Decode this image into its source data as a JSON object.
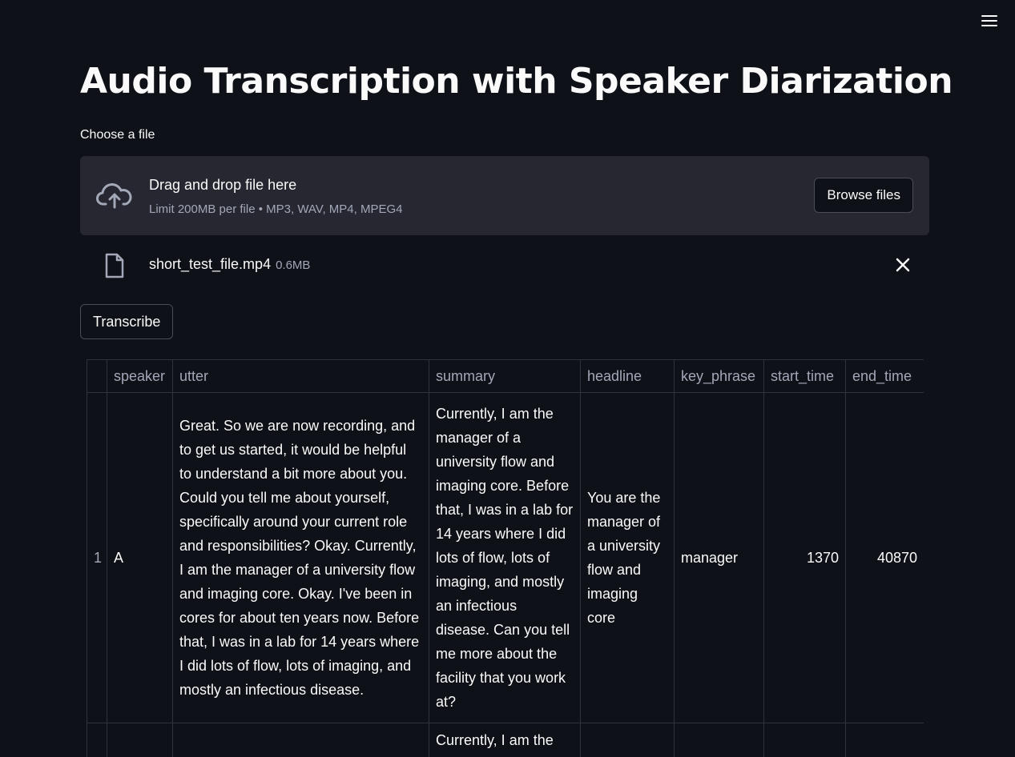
{
  "app": {
    "title": "Audio Transcription with Speaker Diarization",
    "menu_icon": "hamburger-menu-icon"
  },
  "uploader": {
    "label": "Choose a file",
    "drop_text": "Drag and drop file here",
    "limit_text": "Limit 200MB per file • MP3, WAV, MP4, MPEG4",
    "browse_label": "Browse files",
    "icon": "cloud-upload-icon"
  },
  "file": {
    "name": "short_test_file.mp4",
    "size": "0.6MB",
    "icon": "file-icon",
    "close_icon": "close-icon"
  },
  "actions": {
    "transcribe_label": "Transcribe"
  },
  "table": {
    "columns": [
      "",
      "speaker",
      "utter",
      "summary",
      "headline",
      "key_phrase",
      "start_time",
      "end_time"
    ],
    "rows": [
      {
        "index": "1",
        "speaker": "A",
        "utter": "Great. So we are now recording, and to get us started, it would be helpful to understand a bit more about you. Could you tell me about yourself, specifically around your current role and responsibilities? Okay. Currently, I am the manager of a university flow and imaging core. Okay. I've been in cores for about ten years now. Before that, I was in a lab for 14 years where I did lots of flow, lots of imaging, and mostly an infectious disease.",
        "summary": "Currently, I am the manager of a university flow and imaging core. Before that, I was in a lab for 14 years where I did lots of flow, lots of imaging, and mostly an infectious disease. Can you tell me more about the facility that you work at?",
        "headline": "You are the manager of a university flow and imaging core",
        "key_phrase": "manager",
        "start_time": "1370",
        "end_time": "40870"
      },
      {
        "index": "",
        "speaker": "",
        "utter": "",
        "summary": "Currently, I am the manager of a",
        "headline": "",
        "key_phrase": "",
        "start_time": "",
        "end_time": ""
      }
    ]
  }
}
